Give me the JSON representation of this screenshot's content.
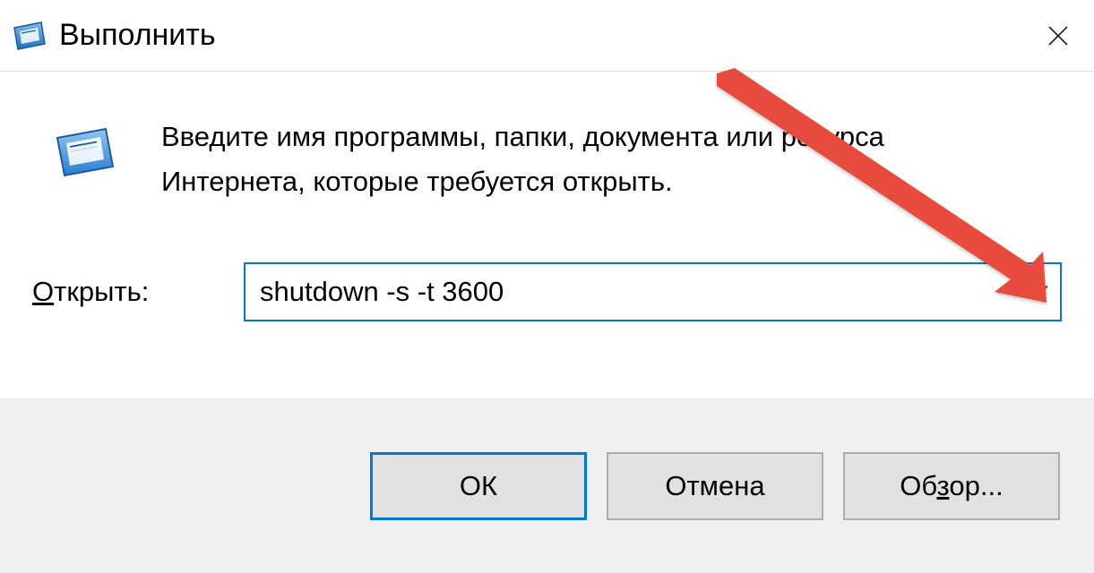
{
  "titlebar": {
    "title": "Выполнить"
  },
  "body": {
    "description": "Введите имя программы, папки, документа или ресурса Интернета, которые требуется открыть.",
    "open_label_prefix": "О",
    "open_label_rest": "ткрыть:",
    "command_value": "shutdown -s -t 3600"
  },
  "buttons": {
    "ok": "ОК",
    "cancel": "Отмена",
    "browse_prefix": "Об",
    "browse_ul": "з",
    "browse_suffix": "ор..."
  }
}
